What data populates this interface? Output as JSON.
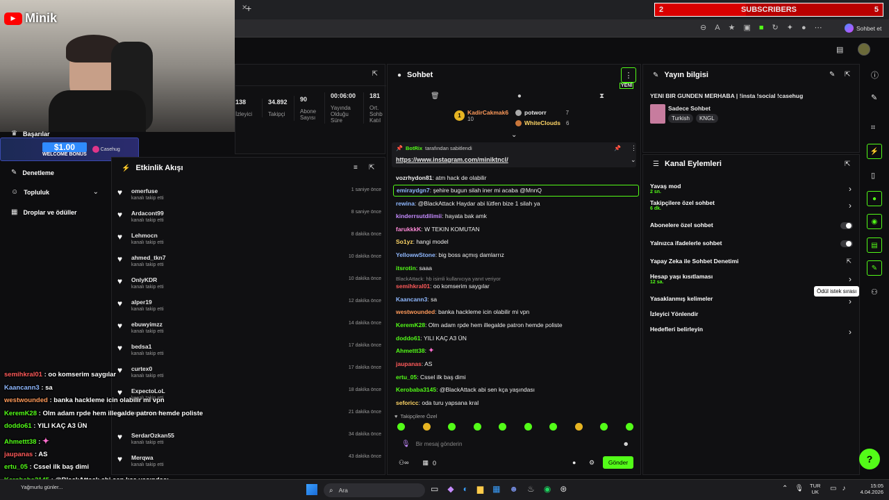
{
  "overlay": {
    "channel_name": "Minik",
    "subscribers": {
      "count": "2",
      "label": "SUBSCRIBERS",
      "goal": "5",
      "progress": 0.4
    },
    "bonus": "$1.00",
    "bonus_label": "WELCOME BONUS",
    "sponsor": "Casehug"
  },
  "browser": {
    "sohbet_label": "Sohbet et"
  },
  "sidebar": {
    "items": [
      {
        "label": "Başarılar"
      },
      {
        "label": "Denetleme"
      },
      {
        "label": "Topluluk"
      },
      {
        "label": "Droplar ve ödüller"
      }
    ]
  },
  "stats": {
    "items": [
      {
        "value": "138",
        "label": "İzleyici"
      },
      {
        "value": "34.892",
        "label": "Takipçi"
      },
      {
        "value": "90",
        "label": "Abone Sayısı"
      },
      {
        "value": "00:06:00",
        "label": "Yayında Olduğu Süre"
      },
      {
        "value": "181",
        "label": "Ort. Sohb Katıl"
      }
    ]
  },
  "activity": {
    "title": "Etkinlik Akışı",
    "items": [
      {
        "user": "omerfuse",
        "action": "kanalı takip etti",
        "time": "1 saniye önce"
      },
      {
        "user": "Ardacont99",
        "action": "kanalı takip etti",
        "time": "8 saniye önce"
      },
      {
        "user": "Lehmocn",
        "action": "kanalı takip etti",
        "time": "8 dakika önce"
      },
      {
        "user": "ahmed_tkn7",
        "action": "kanalı takip etti",
        "time": "10 dakika önce"
      },
      {
        "user": "OnlyKDR",
        "action": "kanalı takip etti",
        "time": "10 dakika önce"
      },
      {
        "user": "alper19",
        "action": "kanalı takip etti",
        "time": "12 dakika önce"
      },
      {
        "user": "ebuwyimzz",
        "action": "kanalı takip etti",
        "time": "14 dakika önce"
      },
      {
        "user": "bedsa1",
        "action": "kanalı takip etti",
        "time": "17 dakika önce"
      },
      {
        "user": "curtex0",
        "action": "kanalı takip etti",
        "time": "17 dakika önce"
      },
      {
        "user": "ExpectoLoL",
        "action": "kanalı takip etti",
        "time": "18 dakika önce"
      },
      {
        "user": "",
        "action": "kanalı takip etti",
        "time": "21 dakika önce"
      },
      {
        "user": "SerdarOzkan55",
        "action": "kanalı takip etti",
        "time": "34 dakika önce"
      },
      {
        "user": "Merqwa",
        "action": "kanalı takip etti",
        "time": "43 dakika önce"
      }
    ]
  },
  "chat": {
    "title": "Sohbet",
    "new_label": "YENİ",
    "leaders": [
      {
        "name": "KadirCakmak6",
        "count": "10"
      },
      {
        "name": "potworr",
        "count": "7"
      },
      {
        "name": "WhiteClouds",
        "count": "6"
      }
    ],
    "pinned": {
      "user": "BotRix",
      "by": "tarafından sabitlendi",
      "text": "https://www.instagram.com/miniktncl/"
    },
    "messages": [
      {
        "user": "vozrhydon81",
        "text": "atm hack de olabilir",
        "color": "#f0f0f0"
      },
      {
        "user": "emiraydgn7",
        "text": "şehire bugun silah iner mi acaba @MnnQ",
        "color": "#8fb8ff"
      },
      {
        "user": "rewina",
        "text": "@BlackAttack Haydar abi lütfen bize 1 silah ya",
        "color": "#8fb8ff"
      },
      {
        "user": "kinderrsutdilimii",
        "text": "hayata bak amk",
        "color": "#c58bff"
      },
      {
        "user": "farukkkK",
        "text": "W TEKIN KOMUTAN",
        "color": "#ff8ad8"
      },
      {
        "user": "So1yz",
        "text": "hangi model",
        "color": "#ffd666"
      },
      {
        "user": "YellowwStone",
        "text": "big boss açmış damlarrız",
        "color": "#8fb8ff"
      },
      {
        "user": "itsrotin",
        "text": "saaa",
        "color": "#53fc18"
      },
      {
        "user": "semihkral01",
        "text": "oo komserim saygılar",
        "color": "#ff5a5a"
      },
      {
        "user": "Kaancann3",
        "text": "sa",
        "color": "#8fb8ff"
      },
      {
        "user": "westwounded",
        "text": "banka hackleme icin olabilir mi vpn",
        "color": "#ff9a5a"
      },
      {
        "user": "KeremK28",
        "text": "Olm adam rpde hem illegalde patron hemde poliste",
        "color": "#53fc18"
      },
      {
        "user": "doddo61",
        "text": "YILI KAÇ A3 ÜN",
        "color": "#53fc18"
      },
      {
        "user": "Ahmettt38",
        "text": "",
        "color": "#53fc18"
      },
      {
        "user": "jaupanas",
        "text": "AS",
        "color": "#ff5a5a"
      },
      {
        "user": "ertu_05",
        "text": "Cssel ilk baş dimi",
        "color": "#53fc18"
      },
      {
        "user": "Kerobaba3145",
        "text": "@BlackAttack abi sen kça yaşındası",
        "color": "#53fc18"
      },
      {
        "user": "seforicc",
        "text": "oda turu yapsana kral",
        "color": "#ffd666"
      }
    ],
    "reply_note": "BlackAttack: hb isimli kullanıcıya yanıt veriyor",
    "followers_only": "Takipçilere Özel",
    "input_placeholder": "Bir mesaj gönderin",
    "points": "0",
    "send_label": "Gönder"
  },
  "stream_info": {
    "title": "Yayın bilgisi",
    "stream_title": "YENI BIR GUNDEN MERHABA | !insta !social !casehug",
    "category": "Sadece Sohbet",
    "tags": [
      "Turkish",
      "KNGL"
    ]
  },
  "channel_actions": {
    "title": "Kanal Eylemleri",
    "items": [
      {
        "label": "Yavaş mod",
        "sub": "2 sn.",
        "control": "arrow"
      },
      {
        "label": "Takipçilere özel sohbet",
        "sub": "6 dk.",
        "control": "arrow"
      },
      {
        "label": "Abonelere özel sohbet",
        "sub": "",
        "control": "toggle"
      },
      {
        "label": "Yalnızca ifadelerle sohbet",
        "sub": "",
        "control": "toggle"
      },
      {
        "label": "Yapay Zeka ile Sohbet Denetimi",
        "sub": "",
        "control": "ext"
      },
      {
        "label": "Hesap yaşı kısıtlaması",
        "sub": "12 sa.",
        "control": "arrow"
      },
      {
        "label": "Yasaklanmış kelimeler",
        "sub": "",
        "control": "arrow"
      },
      {
        "label": "İzleyici Yönlendir",
        "sub": "",
        "control": ""
      },
      {
        "label": "Hedefleri belirleyin",
        "sub": "",
        "control": "arrow"
      }
    ]
  },
  "tooltip": "Ödül istek sırası",
  "overlay_chat": [
    {
      "user": "semihkral01",
      "text": "oo komserim saygılar",
      "color": "#ff5a5a"
    },
    {
      "user": "Kaancann3",
      "text": "sa",
      "color": "#8fb8ff"
    },
    {
      "user": "westwounded",
      "text": "banka hackleme icin olabilir mi vpn",
      "color": "#ff9a5a"
    },
    {
      "user": "KeremK28",
      "text": "Olm adam rpde hem illegalde patron hemde poliste",
      "color": "#53fc18"
    },
    {
      "user": "doddo61",
      "text": "YILI KAÇ A3 ÜN",
      "color": "#53fc18"
    },
    {
      "user": "Ahmettt38",
      "text": "",
      "color": "#53fc18"
    },
    {
      "user": "jaupanas",
      "text": "AS",
      "color": "#ff5a5a"
    },
    {
      "user": "ertu_05",
      "text": "Cssel ilk baş dimi",
      "color": "#53fc18"
    },
    {
      "user": "Kerobaba3145",
      "text": "@BlackAttack abi sen kça yaşındası",
      "color": "#53fc18"
    },
    {
      "user": "seforicc",
      "text": "oda turu yapsana kral",
      "color": "#ffd666"
    }
  ],
  "taskbar": {
    "search": "Ara",
    "weather": "Yağmurlu günler...",
    "lang": "TUR",
    "region": "UK",
    "time": "15:05",
    "date": "4.04.2026"
  }
}
